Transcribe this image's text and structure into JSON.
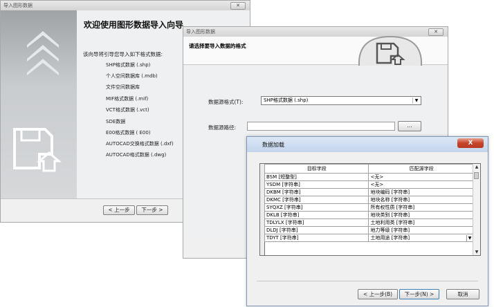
{
  "win1": {
    "title": "导入图形数据",
    "close": "✕",
    "heading": "欢迎使用图形数据导入向导",
    "intro": "该向导将引导您导入如下格式数据:",
    "formats": [
      "SHP格式数据 (.shp)",
      "个人空间数据库 (.mdb)",
      "文件空间数据库",
      "MIF格式数据 (.mif)",
      "VCT格式数据 (.vct)",
      "SDE数据",
      "E00格式数据 ( E00)",
      "AUTOCAD交换格式数据 (.dxf)",
      "AUTOCAD格式数据 (.dwg)"
    ],
    "prev_label": "< 上一步",
    "next_label": "下一步 >"
  },
  "win2": {
    "title": "导入图形数据",
    "close": "✕",
    "header_title": "请选择要导入数据的格式",
    "format_label": "数据源格式(T):",
    "format_value": "SHP格式数据 (.shp)",
    "path_label": "数据源路径:",
    "path_value": "",
    "browse_label": "..."
  },
  "win3": {
    "title": "数据加载",
    "close": "X",
    "grid": {
      "columns": [
        "目标字段",
        "匹配源字段"
      ],
      "rows": [
        [
          "BSM [短整型]",
          "<无>"
        ],
        [
          "YSDM [字符串]",
          "<无>"
        ],
        [
          "DKBM [字符串]",
          "地块编码 [字符串]"
        ],
        [
          "DKMC [字符串]",
          "地块名称 [字符串]"
        ],
        [
          "SYQXZ [字符串]",
          "所有权性质 [字符串]"
        ],
        [
          "DKLB [字符串]",
          "地块类别 [字符串]"
        ],
        [
          "TDLYLX [字符串]",
          "土地利用类 [字符串]"
        ],
        [
          "DLDJ [字符串]",
          "地力等级 [字符串]"
        ],
        [
          "TDYT [字符串]",
          "土地用途 [字符串]"
        ]
      ]
    },
    "prev_label": "< 上一步(B)",
    "next_label": "下一步(N) >",
    "cancel_label": "取消"
  },
  "colors": {
    "side_panel": "#b8bcbf",
    "dialog_titlebar": "#c3d5ec",
    "close_red": "#c7432a"
  },
  "icons": [
    "floppy-import-icon",
    "chevron-up-icon",
    "dropdown-arrow-icon",
    "close-icon"
  ]
}
